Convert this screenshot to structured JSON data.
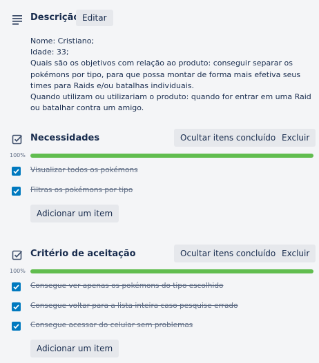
{
  "description": {
    "title": "Descrição",
    "edit_label": "Editar",
    "lines": [
      "Nome: Cristiano;",
      "Idade: 33;",
      "Quais são os objetivos com relação ao produto: conseguir separar os pokémons por tipo, para que possa montar de forma mais efetiva seus times para Raids e/ou batalhas individuais.",
      "Quando utilizam ou utilizariam o produto: quando for entrar em uma Raid ou batalhar contra um amigo."
    ]
  },
  "checklists": [
    {
      "title": "Necessidades",
      "hide_label": "Ocultar itens concluídos",
      "delete_label": "Excluir",
      "progress": "100%",
      "progress_value": 1.0,
      "items": [
        {
          "text": "Visualizar todos os pokémons",
          "checked": true
        },
        {
          "text": "Filtras os pokémons por tipo",
          "checked": true
        }
      ],
      "add_label": "Adicionar um item"
    },
    {
      "title": "Critério de aceitação",
      "hide_label": "Ocultar itens concluídos",
      "delete_label": "Excluir",
      "progress": "100%",
      "progress_value": 1.0,
      "items": [
        {
          "text": "Consegue ver apenas os pokémons do tipo escolhido",
          "checked": true
        },
        {
          "text": "Consegue voltar para a lista inteira caso pesquise errado",
          "checked": true
        },
        {
          "text": "Consegue acessar do celular sem problemas",
          "checked": true
        }
      ],
      "add_label": "Adicionar um item"
    }
  ],
  "colors": {
    "checkbox": "#0079bf",
    "progress": "#61bd4f",
    "button_bg": "#e6e8ec"
  },
  "icons": {
    "description": "description-lines-icon",
    "checklist": "checklist-icon",
    "check": "check-icon"
  }
}
